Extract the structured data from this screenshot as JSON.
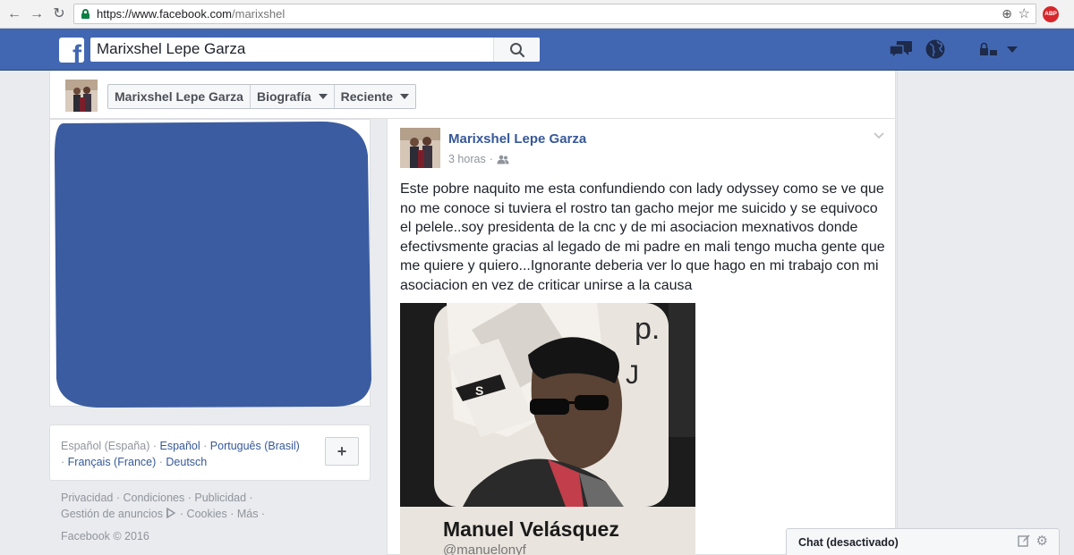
{
  "browser": {
    "url_prefix": "https://www.facebook.com",
    "url_path": "/marixshel",
    "back_icon": "←",
    "forward_icon": "→",
    "reload_icon": "↻",
    "zoom_icon": "⊕",
    "star_icon": "☆",
    "adblock_label": "ABP"
  },
  "fb_header": {
    "logo": "f",
    "search_value": "Marixshel Lepe Garza",
    "icons": [
      "friend-requests-icon",
      "messages-icon",
      "notifications-globe-icon",
      "privacy-icon",
      "account-menu-icon"
    ]
  },
  "profile_nav": {
    "name": "Marixshel Lepe Garza",
    "tab_biografia": "Biografía",
    "tab_reciente": "Reciente"
  },
  "languages": {
    "current": "Español (España)",
    "sep": " · ",
    "l1": "Español",
    "l2": "Português (Brasil)",
    "l3": "Français (France)",
    "l4": "Deutsch",
    "add_button": "+"
  },
  "footer": {
    "line1": "Privacidad · Condiciones · Publicidad ·",
    "line2a": "Gestión de anuncios",
    "line2b": " · Cookies · Más ·",
    "copyright": "Facebook © 2016"
  },
  "post": {
    "author": "Marixshel Lepe Garza",
    "time": "3 horas",
    "dot": "·",
    "text": "Este pobre naquito me esta confundiendo con lady odyssey como se ve que no me conoce si tuviera el rostro tan gacho mejor me suicido y se equivoco el pelele..soy presidenta de la cnc y de mi asociacion mexnativos donde efectivsmente gracias al legado de mi padre en mali tengo mucha gente que me quiere y quiero...Ignorante deberia ver lo que hago en mi trabajo con mi asociacion en vez de criticar unirse a la causa",
    "image_name": "Manuel Velásquez",
    "image_handle": "@manuelonyf"
  },
  "chat": {
    "label": "Chat (desactivado)",
    "gear_icon": "⚙"
  },
  "colors": {
    "fb_blue": "#4267b2",
    "link": "#365899",
    "redaction": "#3b5ca0"
  }
}
